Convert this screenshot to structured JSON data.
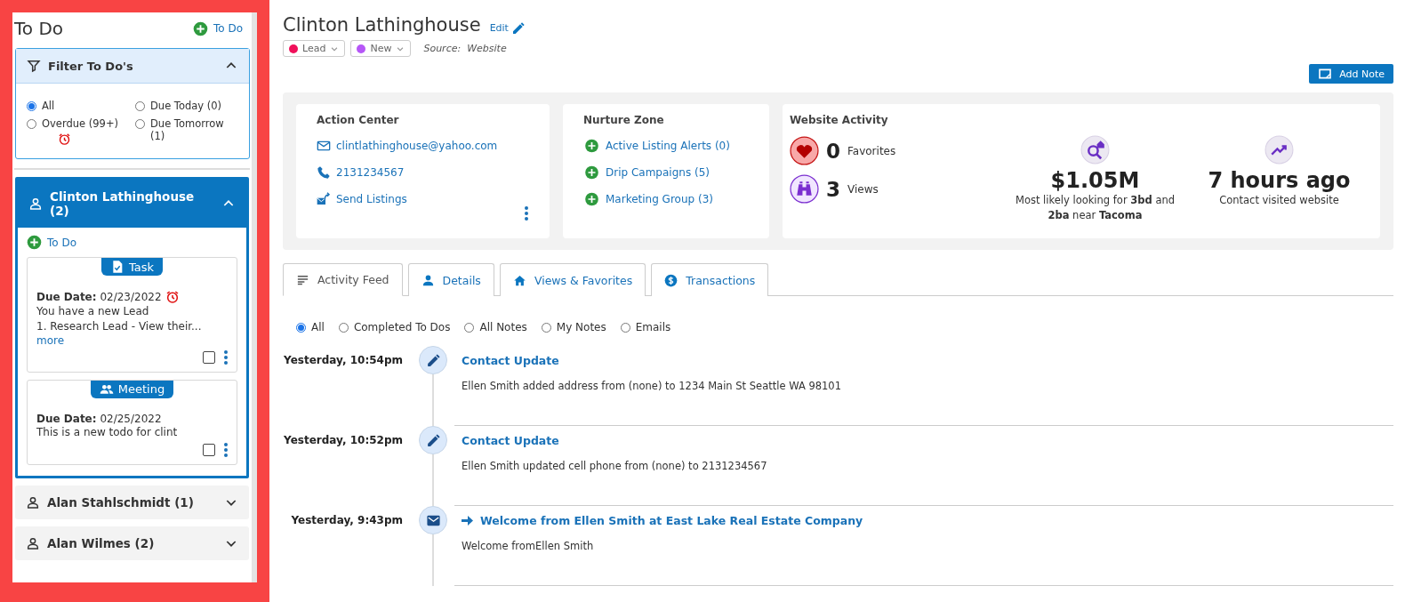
{
  "sidebar": {
    "title": "To Do",
    "add_link": "To Do",
    "filter": {
      "title": "Filter To Do's",
      "expanded": true,
      "options": [
        {
          "label": "All",
          "selected": true,
          "overdue": false
        },
        {
          "label": "Due Today (0)",
          "selected": false,
          "overdue": false
        },
        {
          "label": "Overdue (99+)",
          "selected": false,
          "overdue": true
        },
        {
          "label": "Due Tomorrow (1)",
          "selected": false,
          "overdue": false
        }
      ]
    },
    "contacts": [
      {
        "name": "Clinton Lathinghouse (2)",
        "expanded": true,
        "add_link": "To Do",
        "todos": [
          {
            "kind": "task",
            "badge": "Task",
            "due": "**Due Date:** 02/23/2022",
            "overdue": true,
            "lines": [
              "You have a new Lead",
              "1. Research Lead - View their..."
            ],
            "more": "more",
            "checked": false
          },
          {
            "kind": "meeting",
            "badge": "Meeting",
            "due": "**Due Date:** 02/25/2022",
            "overdue": false,
            "lines": [
              "This is a new todo for clint"
            ],
            "checked": false
          }
        ]
      },
      {
        "name": "Alan Stahlschmidt (1)",
        "expanded": false
      },
      {
        "name": "Alan Wilmes (2)",
        "expanded": false
      }
    ]
  },
  "contact": {
    "name": "Clinton Lathinghouse",
    "edit_link": "Edit",
    "tags": [
      {
        "label": "Lead",
        "color": "#f0105a"
      },
      {
        "label": "New",
        "color": "#b657f7"
      }
    ],
    "source": "Source:  Website",
    "add_note_button": "Add Note"
  },
  "action_center": {
    "title": "Action Center",
    "items": [
      {
        "kind": "email",
        "label": "clintlathinghouse@yahoo.com"
      },
      {
        "kind": "phone",
        "label": "2131234567"
      },
      {
        "kind": "send",
        "label": "Send Listings"
      }
    ]
  },
  "nurture_zone": {
    "title": "Nurture Zone",
    "items": [
      "Active Listing Alerts (0)",
      "Drip Campaigns (5)",
      "Marketing Group (3)"
    ]
  },
  "website_activity": {
    "title": "Website Activity",
    "counts": [
      {
        "kind": "favorites",
        "count": "0",
        "label": "Favorites"
      },
      {
        "kind": "views",
        "count": "3",
        "label": "Views"
      }
    ],
    "highlights": [
      {
        "kind": "search",
        "value": "$1.05M",
        "description": "Most likely looking for **3bd** and **2ba** near **Tacoma**"
      },
      {
        "kind": "trend",
        "value": "7 hours ago",
        "description": "Contact visited website"
      }
    ]
  },
  "tabs": [
    {
      "kind": "feed",
      "label": "Activity Feed",
      "selected": true
    },
    {
      "kind": "person",
      "label": "Details",
      "selected": false
    },
    {
      "kind": "home",
      "label": "Views & Favorites",
      "selected": false
    },
    {
      "kind": "dollar",
      "label": "Transactions",
      "selected": false
    }
  ],
  "feed_filters": [
    {
      "label": "All",
      "selected": true
    },
    {
      "label": "Completed To Dos",
      "selected": false
    },
    {
      "label": "All Notes",
      "selected": false
    },
    {
      "label": "My Notes",
      "selected": false
    },
    {
      "label": "Emails",
      "selected": false
    }
  ],
  "feed": [
    {
      "kind": "edit",
      "time": "Yesterday, 10:54pm",
      "title": "Contact Update",
      "body": "Ellen Smith added address from (none) to 1234 Main St Seattle WA 98101"
    },
    {
      "kind": "edit",
      "time": "Yesterday, 10:52pm",
      "title": "Contact Update",
      "body": "Ellen Smith updated cell phone from (none) to 2131234567"
    },
    {
      "kind": "email",
      "time": "Yesterday, 9:43pm",
      "title": "Welcome from Ellen Smith at East Lake Real Estate Company",
      "body": "Welcome fromEllen Smith"
    }
  ]
}
